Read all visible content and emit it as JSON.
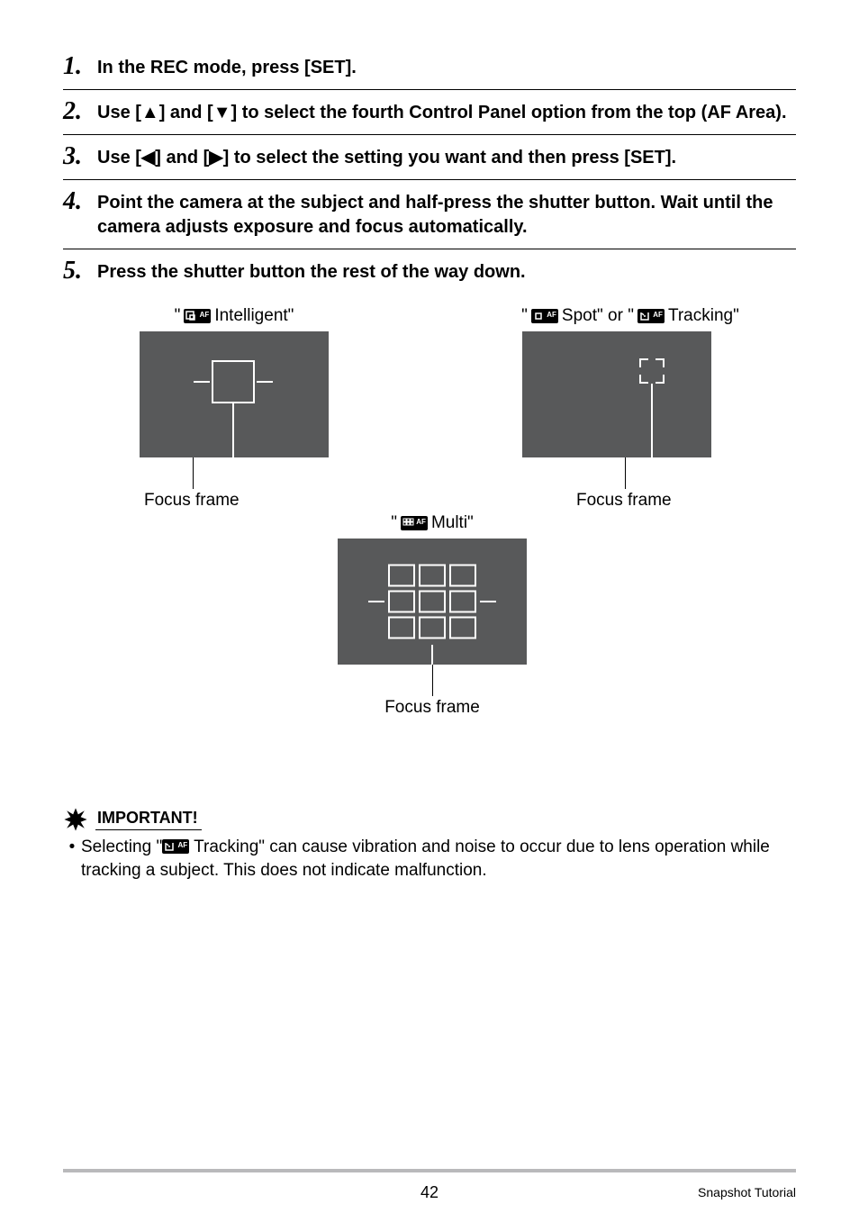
{
  "steps": [
    {
      "num": "1",
      "text": "In the REC mode, press [SET]."
    },
    {
      "num": "2",
      "text": "Use [▲] and [▼] to select the fourth Control Panel option from the top (AF Area)."
    },
    {
      "num": "3",
      "text": "Use [◀] and [▶] to select the setting you want and then press [SET]."
    },
    {
      "num": "4",
      "text": "Point the camera at the subject and half-press the shutter button. Wait until the camera adjusts exposure and focus automatically."
    },
    {
      "num": "5",
      "text": "Press the shutter button the rest of the way down."
    }
  ],
  "diagrams": {
    "intelligent": {
      "label_pre": "\"",
      "label_mid": " Intelligent\"",
      "caption": "Focus frame"
    },
    "spot_tracking": {
      "label_pre": "\"",
      "spot": " Spot\" or \"",
      "tracking": " Tracking\"",
      "caption": "Focus frame"
    },
    "multi": {
      "label_pre": "\"",
      "label_mid": " Multi\"",
      "caption": "Focus frame"
    }
  },
  "important": {
    "heading": "IMPORTANT!",
    "bullet_pre": "Selecting \"",
    "bullet_post": " Tracking\" can cause vibration and noise to occur due to lens operation while tracking a subject. This does not indicate malfunction."
  },
  "footer": {
    "page": "42",
    "section": "Snapshot Tutorial"
  },
  "af_text": "AF"
}
